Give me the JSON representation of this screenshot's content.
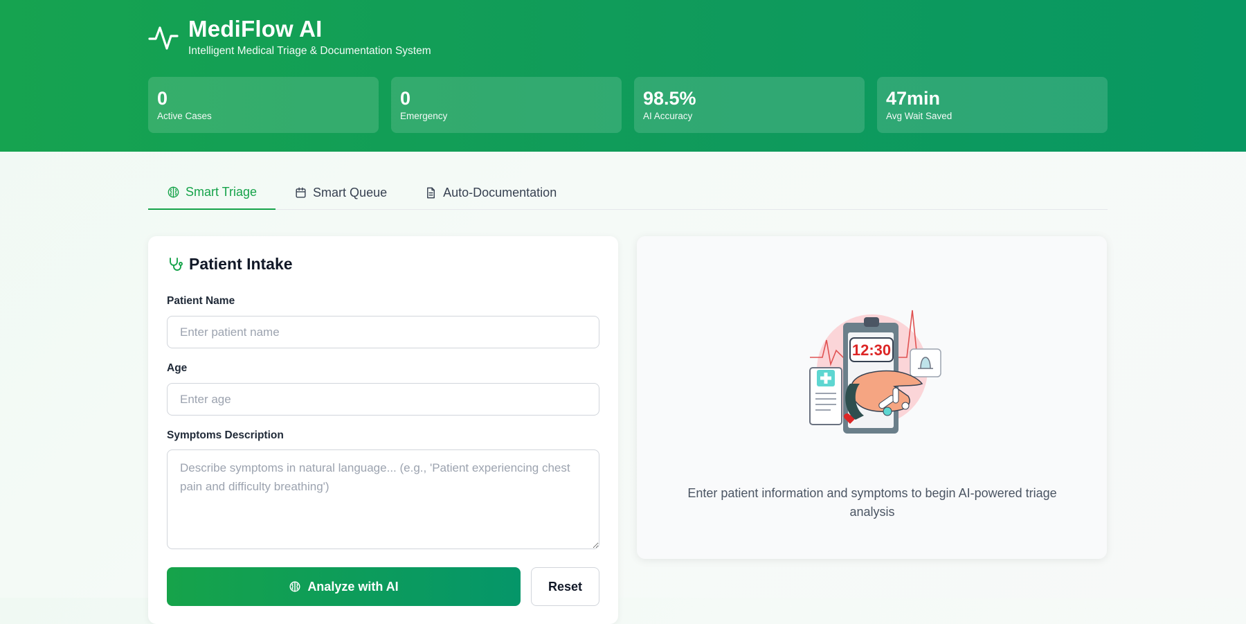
{
  "header": {
    "title": "MediFlow AI",
    "subtitle": "Intelligent Medical Triage & Documentation System"
  },
  "stats": [
    {
      "value": "0",
      "label": "Active Cases"
    },
    {
      "value": "0",
      "label": "Emergency"
    },
    {
      "value": "98.5%",
      "label": "AI Accuracy"
    },
    {
      "value": "47min",
      "label": "Avg Wait Saved"
    }
  ],
  "tabs": [
    {
      "label": "Smart Triage",
      "icon": "brain-icon",
      "active": true
    },
    {
      "label": "Smart Queue",
      "icon": "calendar-icon",
      "active": false
    },
    {
      "label": "Auto-Documentation",
      "icon": "document-icon",
      "active": false
    }
  ],
  "intake": {
    "title": "Patient Intake",
    "icon": "stethoscope-icon",
    "name_label": "Patient Name",
    "name_placeholder": "Enter patient name",
    "age_label": "Age",
    "age_placeholder": "Enter age",
    "symptoms_label": "Symptoms Description",
    "symptoms_placeholder": "Describe symptoms in natural language... (e.g., 'Patient experiencing chest pain and difficulty breathing')",
    "analyze_label": "Analyze with AI",
    "reset_label": "Reset"
  },
  "result": {
    "clock_text": "12:30",
    "message": "Enter patient information and symptoms to begin AI-powered triage analysis"
  },
  "colors": {
    "brand_green": "#16a34a",
    "header_gradient_end": "#089862"
  }
}
